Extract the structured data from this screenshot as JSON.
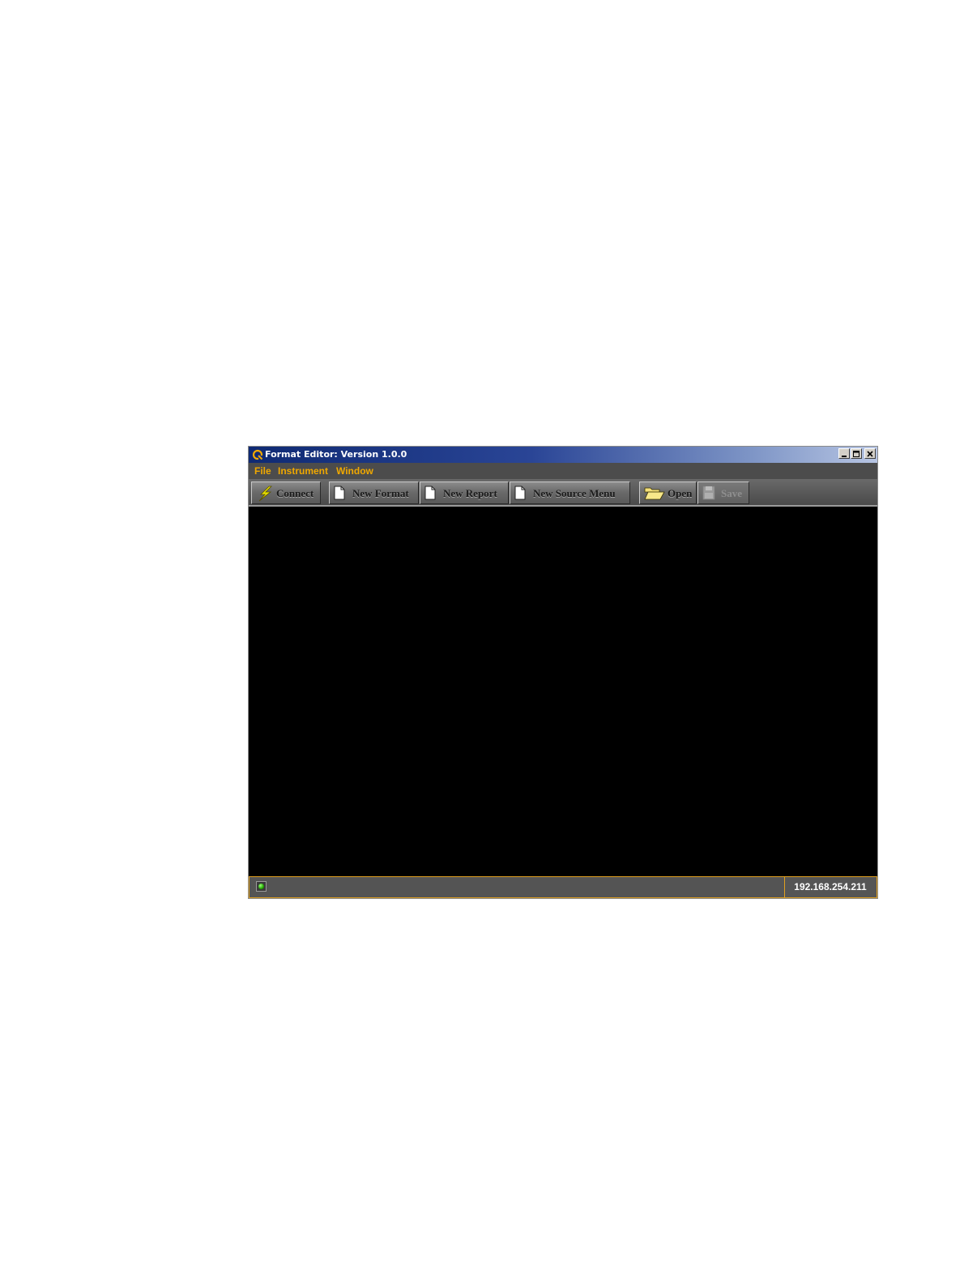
{
  "window": {
    "title": "Format Editor: Version 1.0.0",
    "title_icon": "app-logo-icon",
    "controls": [
      "minimize-icon",
      "maximize-icon",
      "close-icon"
    ]
  },
  "menu": {
    "items": [
      {
        "label": "File"
      },
      {
        "label": "Instrument"
      },
      {
        "label": "Window"
      }
    ],
    "color": "#f0a800"
  },
  "toolbar": {
    "connect_label": "Connect",
    "new_format_label": "New Format",
    "new_report_label": "New Report",
    "new_source_menu_label": "New Source Menu",
    "open_label": "Open",
    "save_label": "Save",
    "save_enabled": false
  },
  "status": {
    "connection_indicator": "green-led-icon",
    "ip_address": "192.168.254.211",
    "accent": "#e0a020"
  }
}
